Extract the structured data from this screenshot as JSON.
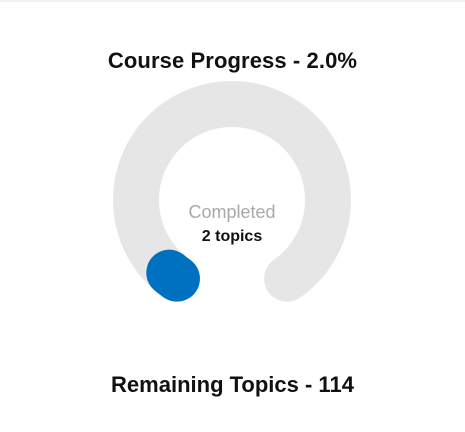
{
  "progress": {
    "title": "Course Progress - 2.0%",
    "percent": 2.0,
    "center_label": "Completed",
    "center_value": "2 topics",
    "remaining_text": "Remaining Topics - 114"
  },
  "colors": {
    "track": "#e6e6e6",
    "fill": "#0070c0"
  }
}
